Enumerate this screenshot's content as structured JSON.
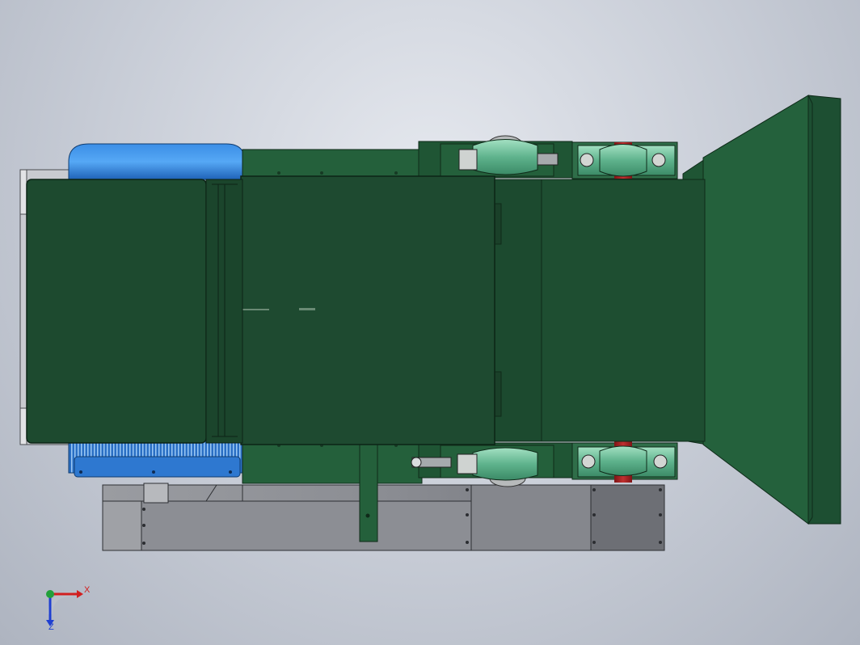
{
  "view": {
    "title": "",
    "background_top": "#e6e9ef",
    "background_bottom": "#aeb4c0"
  },
  "model": {
    "colors": {
      "housing_green": "#1e4a30",
      "housing_green_dark": "#173b26",
      "motor_blue": "#2f7fd6",
      "steel_gray": "#8e9096",
      "bearing_teal": "#6fbf9c",
      "shaft_red": "#a21f22"
    },
    "components": [
      {
        "id": "motor",
        "icon": "electric-motor-icon"
      },
      {
        "id": "guard",
        "icon": "belt-guard-icon"
      },
      {
        "id": "crusher-body",
        "icon": "housing-icon"
      },
      {
        "id": "bearing",
        "icon": "pillow-block-bearing-icon"
      },
      {
        "id": "hopper",
        "icon": "feed-hopper-icon"
      },
      {
        "id": "base",
        "icon": "base-frame-icon"
      }
    ]
  },
  "triad": {
    "x_label": "X",
    "z_label": "Z",
    "x_color": "#d11f1f",
    "y_color": "#22a03a",
    "z_color": "#1f3fd1"
  }
}
